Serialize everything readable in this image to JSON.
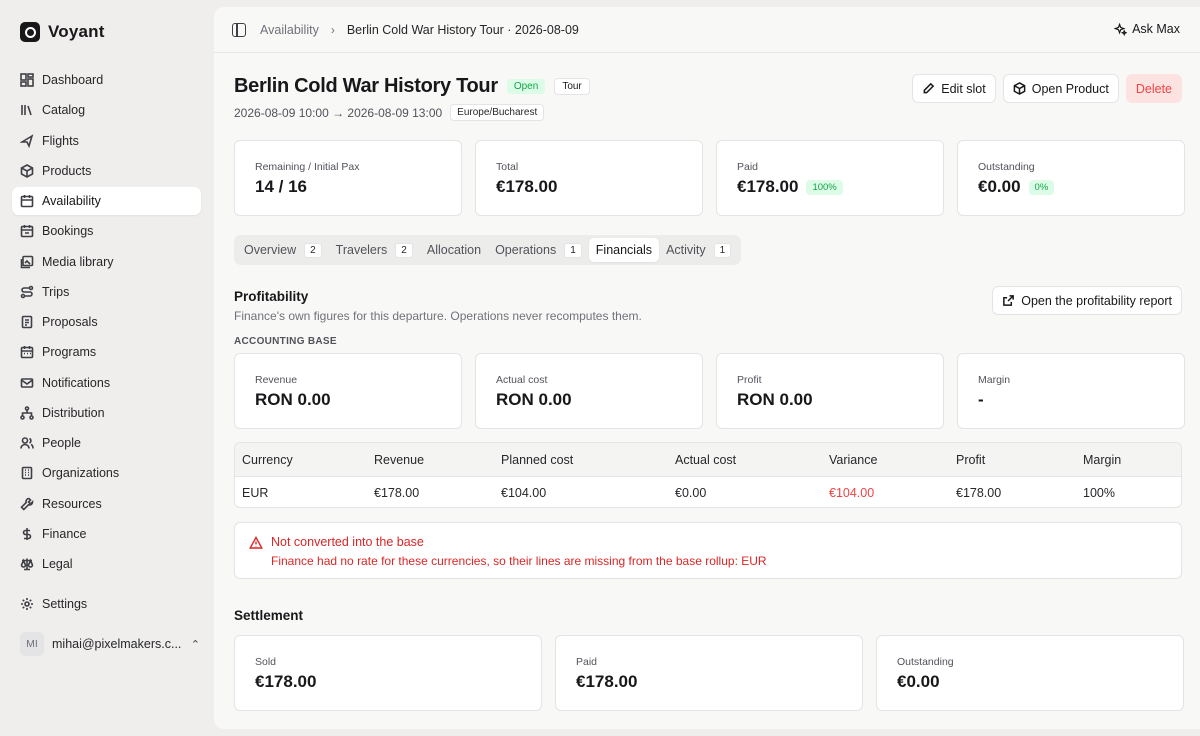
{
  "brand": {
    "name": "Voyant"
  },
  "nav": {
    "items": [
      {
        "label": "Dashboard",
        "icon": "dashboard-icon"
      },
      {
        "label": "Catalog",
        "icon": "library-icon"
      },
      {
        "label": "Flights",
        "icon": "plane-icon"
      },
      {
        "label": "Products",
        "icon": "package-icon"
      },
      {
        "label": "Availability",
        "icon": "calendar-icon"
      },
      {
        "label": "Bookings",
        "icon": "calendar-check-icon"
      },
      {
        "label": "Media library",
        "icon": "images-icon"
      },
      {
        "label": "Trips",
        "icon": "route-icon"
      },
      {
        "label": "Proposals",
        "icon": "document-icon"
      },
      {
        "label": "Programs",
        "icon": "calendar-grid-icon"
      },
      {
        "label": "Notifications",
        "icon": "mail-icon"
      },
      {
        "label": "Distribution",
        "icon": "network-icon"
      },
      {
        "label": "People",
        "icon": "users-icon"
      },
      {
        "label": "Organizations",
        "icon": "building-icon"
      },
      {
        "label": "Resources",
        "icon": "wrench-icon"
      },
      {
        "label": "Finance",
        "icon": "dollar-icon"
      },
      {
        "label": "Legal",
        "icon": "scale-icon"
      }
    ],
    "active_index": 4,
    "settings_label": "Settings"
  },
  "user": {
    "initials": "MI",
    "email": "mihai@pixelmakers.c..."
  },
  "topbar": {
    "breadcrumb_root": "Availability",
    "breadcrumb_current": "Berlin Cold War History Tour · 2026-08-09",
    "ask_label": "Ask Max"
  },
  "header": {
    "title": "Berlin Cold War History Tour",
    "status_badge": "Open",
    "type_badge": "Tour",
    "time_range": "2026-08-09 10:00 → 2026-08-09 13:00",
    "timezone": "Europe/Bucharest"
  },
  "actions": {
    "edit": "Edit slot",
    "open_product": "Open Product",
    "delete": "Delete"
  },
  "summary_cards": [
    {
      "label": "Remaining / Initial Pax",
      "value": "14 / 16",
      "badge": ""
    },
    {
      "label": "Total",
      "value": "€178.00",
      "badge": ""
    },
    {
      "label": "Paid",
      "value": "€178.00",
      "badge": "100%"
    },
    {
      "label": "Outstanding",
      "value": "€0.00",
      "badge": "0%"
    }
  ],
  "tabs": [
    {
      "label": "Overview",
      "count": "2"
    },
    {
      "label": "Travelers",
      "count": "2"
    },
    {
      "label": "Allocation",
      "count": ""
    },
    {
      "label": "Operations",
      "count": "1"
    },
    {
      "label": "Financials",
      "count": ""
    },
    {
      "label": "Activity",
      "count": "1"
    }
  ],
  "active_tab": 4,
  "profitability": {
    "title": "Profitability",
    "description": "Finance's own figures for this departure. Operations never recomputes them.",
    "caption": "ACCOUNTING BASE",
    "report_button": "Open the profitability report",
    "cards": [
      {
        "label": "Revenue",
        "value": "RON 0.00"
      },
      {
        "label": "Actual cost",
        "value": "RON 0.00"
      },
      {
        "label": "Profit",
        "value": "RON 0.00"
      },
      {
        "label": "Margin",
        "value": "-"
      }
    ],
    "table": {
      "headers": [
        "Currency",
        "Revenue",
        "Planned cost",
        "Actual cost",
        "Variance",
        "Profit",
        "Margin"
      ],
      "rows": [
        [
          "EUR",
          "€178.00",
          "€104.00",
          "€0.00",
          "€104.00",
          "€178.00",
          "100%"
        ]
      ]
    },
    "alert": {
      "title": "Not converted into the base",
      "body": "Finance had no rate for these currencies, so their lines are missing from the base rollup: EUR"
    }
  },
  "settlement": {
    "title": "Settlement",
    "cards": [
      {
        "label": "Sold",
        "value": "€178.00"
      },
      {
        "label": "Paid",
        "value": "€178.00"
      },
      {
        "label": "Outstanding",
        "value": "€0.00"
      }
    ]
  },
  "colors": {
    "success": "#16a34a",
    "danger": "#ef4444",
    "accent": "#18181b"
  }
}
